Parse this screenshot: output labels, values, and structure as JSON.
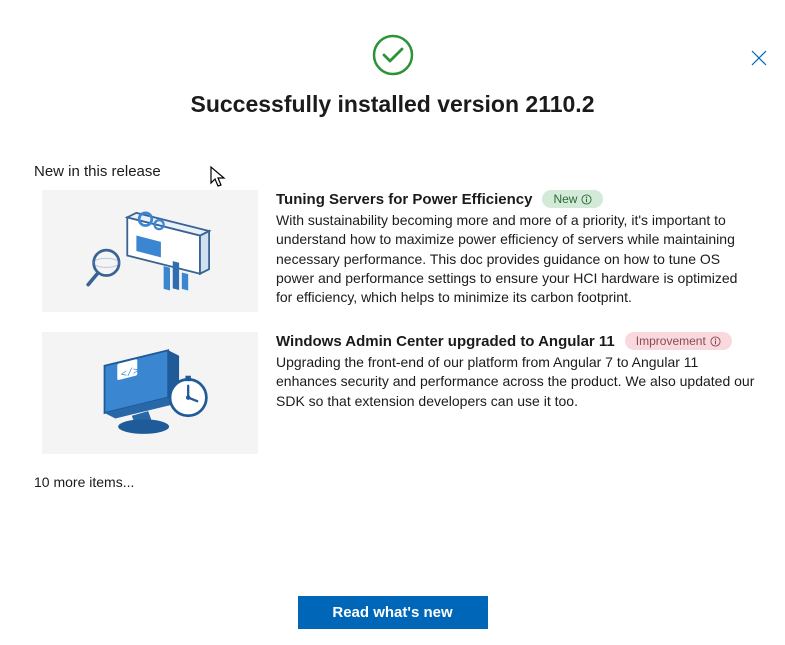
{
  "title": "Successfully installed version 2110.2",
  "section_header": "New in this release",
  "items": [
    {
      "title": "Tuning Servers for Power Efficiency",
      "badge_label": "New",
      "badge_type": "new",
      "description": "With sustainability becoming more and more of a priority, it's important to understand how to maximize power efficiency of servers while maintaining necessary performance. This doc provides guidance on how to tune OS power and performance settings to ensure your HCI hardware is optimized for efficiency, which helps to minimize its carbon footprint."
    },
    {
      "title": "Windows Admin Center upgraded to Angular 11",
      "badge_label": "Improvement",
      "badge_type": "improvement",
      "description": "Upgrading the front-end of our platform from Angular 7 to Angular 11 enhances security and performance across the product. We also updated our SDK so that extension developers can use it too."
    }
  ],
  "more_items_text": "10 more items...",
  "cta_label": "Read what's new",
  "colors": {
    "primary": "#0067b8",
    "success": "#2b9438"
  }
}
